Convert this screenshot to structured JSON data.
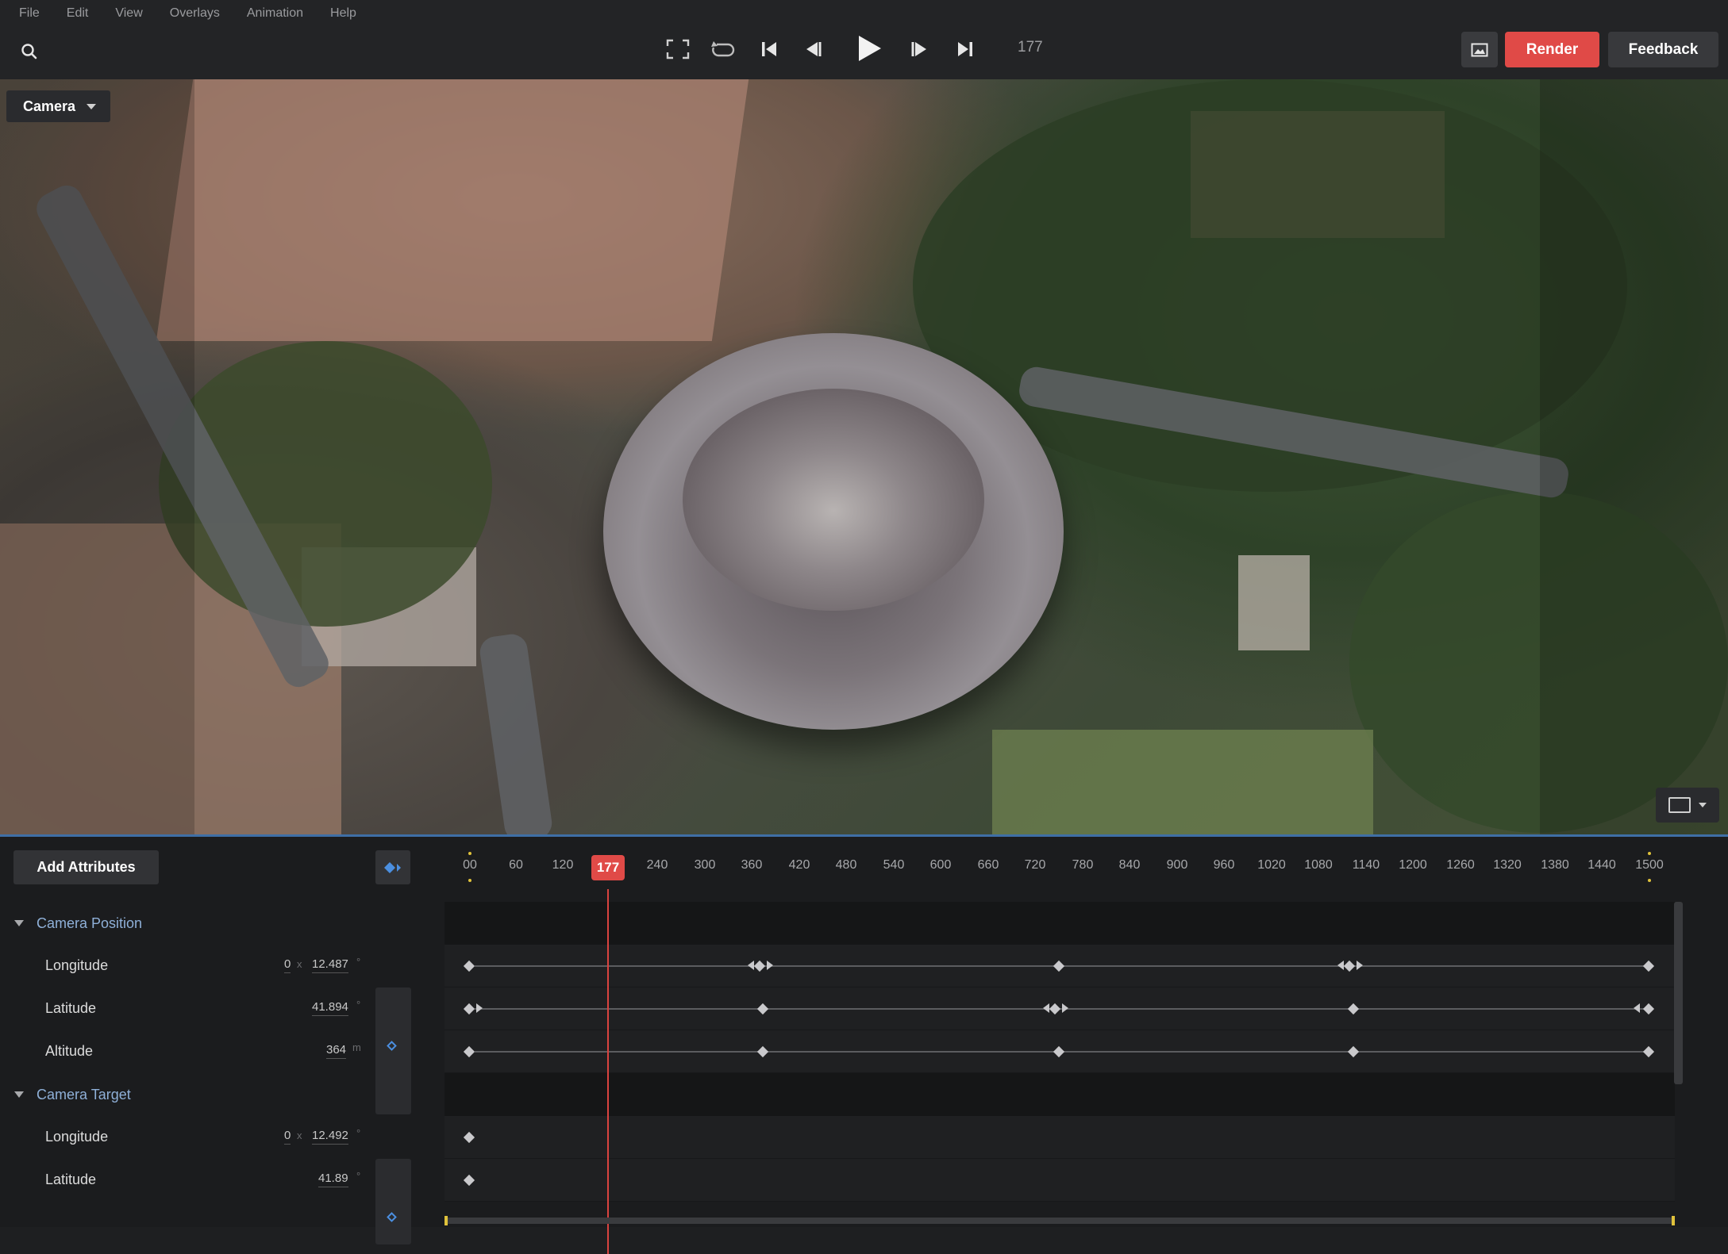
{
  "menu": [
    "File",
    "Edit",
    "View",
    "Overlays",
    "Animation",
    "Help"
  ],
  "transport": {
    "frame": "177",
    "icons": [
      "fullscreen-icon",
      "loop-icon",
      "skip-start-icon",
      "step-back-icon",
      "play-icon",
      "step-forward-icon",
      "skip-end-icon"
    ]
  },
  "actions": {
    "render": "Render",
    "feedback": "Feedback"
  },
  "viewport": {
    "camera_label": "Camera"
  },
  "timeline": {
    "add_attributes": "Add Attributes",
    "ruler_ticks": [
      "00",
      "60",
      "120",
      "240",
      "300",
      "360",
      "420",
      "480",
      "540",
      "600",
      "660",
      "720",
      "780",
      "840",
      "900",
      "960",
      "1020",
      "1080",
      "1140",
      "1200",
      "1260",
      "1320",
      "1380",
      "1440",
      "1500"
    ],
    "playhead_frame": "177",
    "groups": [
      {
        "name": "Camera Position",
        "attributes": [
          {
            "name": "Longitude",
            "prefix": "0",
            "value": "12.487",
            "unit": "°"
          },
          {
            "name": "Latitude",
            "value": "41.894",
            "unit": "°"
          },
          {
            "name": "Altitude",
            "value": "364",
            "unit": "m"
          }
        ]
      },
      {
        "name": "Camera Target",
        "attributes": [
          {
            "name": "Longitude",
            "prefix": "0",
            "value": "12.492",
            "unit": "°"
          },
          {
            "name": "Latitude",
            "value": "41.89",
            "unit": "°"
          }
        ]
      }
    ]
  },
  "colors": {
    "accent_red": "#e04a47",
    "accent_blue": "#4b8fe0",
    "group_text": "#8fb0d8"
  }
}
